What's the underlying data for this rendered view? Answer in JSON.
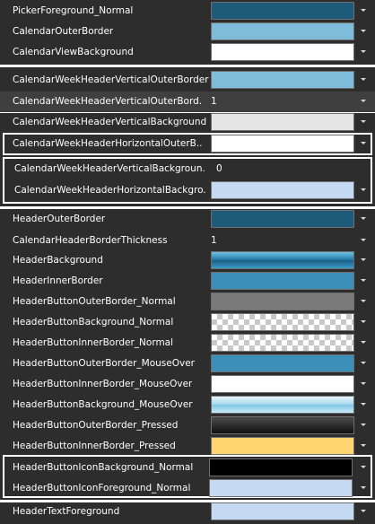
{
  "rows": [
    {
      "label": "PickerForeground_Normal",
      "color": "#1d5b78"
    },
    {
      "label": "CalendarOuterBorder",
      "color": "#7fbcda"
    },
    {
      "label": "CalendarViewBackground",
      "color": "#ffffff"
    },
    {
      "label": "CalendarWeekHeaderVerticalOuterBorder",
      "color": "#7fbcda"
    },
    {
      "label": "CalendarWeekHeaderVerticalOuterBord...",
      "value": "1"
    },
    {
      "label": "CalendarWeekHeaderVerticalBackground",
      "color": "#e4e4e4"
    },
    {
      "label": "CalendarWeekHeaderHorizontalOuterB...",
      "color": "#ffffff"
    },
    {
      "label": "CalendarWeekHeaderVerticalBackgroun...",
      "value": "0"
    },
    {
      "label": "CalendarWeekHeaderHorizontalBackgro...",
      "color": "#c5d9f2"
    },
    {
      "label": "HeaderOuterBorder",
      "color": "#1d5b78"
    },
    {
      "label": "CalendarHeaderBorderThickness",
      "value": "1"
    },
    {
      "label": "HeaderBackground",
      "color": "#2f86b0"
    },
    {
      "label": "HeaderInnerBorder",
      "color": "#3b8fb8"
    },
    {
      "label": "HeaderButtonOuterBorder_Normal",
      "color": "#7a7a7a"
    },
    {
      "label": "HeaderButtonBackground_Normal",
      "color": "transparent"
    },
    {
      "label": "HeaderButtonInnerBorder_Normal",
      "color": "transparent"
    },
    {
      "label": "HeaderButtonOuterBorder_MouseOver",
      "color": "#3b8fb8"
    },
    {
      "label": "HeaderButtonInnerBorder_MouseOver",
      "color": "#ffffff"
    },
    {
      "label": "HeaderButtonBackground_MouseOver",
      "color": "#8fcbe6"
    },
    {
      "label": "HeaderButtonOuterBorder_Pressed",
      "color": "#1a1a1a"
    },
    {
      "label": "HeaderButtonInnerBorder_Pressed",
      "color": "#ffd56f"
    },
    {
      "label": "HeaderButtonIconBackground_Normal",
      "color": "#000000"
    },
    {
      "label": "HeaderButtonIconForeground_Normal",
      "color": "#c5d9f2"
    },
    {
      "label": "HeaderTextForeground",
      "color": "#c5d9f2"
    }
  ]
}
